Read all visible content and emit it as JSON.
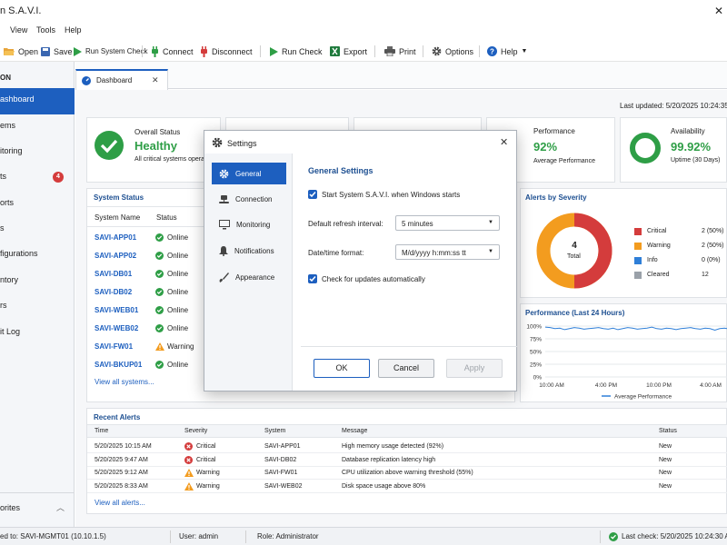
{
  "title": "n S.A.V.I.",
  "menu": [
    "View",
    "Tools",
    "Help"
  ],
  "toolbar": {
    "open": "Open",
    "save": "Save",
    "run_system_check": "Run System Check",
    "connect": "Connect",
    "disconnect": "Disconnect",
    "run_check": "Run Check",
    "export": "Export",
    "print": "Print",
    "options": "Options",
    "help": "Help"
  },
  "sidebar": {
    "header": "ON",
    "items": [
      "ashboard",
      "ems",
      "itoring",
      "ts",
      "orts",
      "s",
      "figurations",
      "ntory",
      "rs",
      "it Log"
    ],
    "alerts_badge": "4",
    "favorites": "orites"
  },
  "tab": {
    "label": "Dashboard"
  },
  "last_updated": "Last updated: 5/20/2025 10:24:35 A",
  "overall": {
    "label": "Overall Status",
    "value": "Healthy",
    "sub": "All critical systems operatio"
  },
  "performance": {
    "label": "Performance",
    "value": "92%",
    "sub": "Average Performance"
  },
  "availability": {
    "label": "Availability",
    "value": "99.92%",
    "sub": "Uptime (30 Days)",
    "fraction": 0.9992
  },
  "system_status": {
    "title": "System Status",
    "headers": [
      "System Name",
      "Status"
    ],
    "rows": [
      {
        "name": "SAVI-APP01",
        "status": "Online"
      },
      {
        "name": "SAVI-APP02",
        "status": "Online"
      },
      {
        "name": "SAVI-DB01",
        "status": "Online"
      },
      {
        "name": "SAVI-DB02",
        "status": "Online"
      },
      {
        "name": "SAVI-WEB01",
        "status": "Online"
      },
      {
        "name": "SAVI-WEB02",
        "status": "Online"
      },
      {
        "name": "SAVI-FW01",
        "status": "Warning"
      },
      {
        "name": "SAVI-BKUP01",
        "status": "Online"
      }
    ],
    "view_all": "View all systems..."
  },
  "alerts_by_severity": {
    "title": "Alerts by Severity",
    "total": "4",
    "total_label": "Total",
    "legend": [
      {
        "label": "Critical",
        "value": "2 (50%)",
        "color": "#d43c3c"
      },
      {
        "label": "Warning",
        "value": "2 (50%)",
        "color": "#f39c1f"
      },
      {
        "label": "Info",
        "value": "0 (0%)",
        "color": "#2f7fd8"
      },
      {
        "label": "Cleared",
        "value": "12",
        "color": "#9aa1a9"
      }
    ]
  },
  "chart_data": {
    "type": "line",
    "title": "Performance (Last 24 Hours)",
    "x": [
      "10:00 AM",
      "4:00 PM",
      "10:00 PM",
      "4:00 AM"
    ],
    "y_ticks": [
      "100%",
      "75%",
      "50%",
      "25%",
      "0%"
    ],
    "ylim": [
      0,
      100
    ],
    "legend": "Average Performance",
    "series": [
      {
        "name": "Average Performance",
        "values": [
          98,
          97,
          95,
          96,
          93,
          95,
          97,
          96,
          94,
          95,
          96,
          97,
          95,
          94,
          96,
          93,
          95,
          97,
          96,
          94,
          95,
          96,
          98,
          95,
          94,
          96,
          95,
          93,
          95,
          96,
          97,
          95,
          94,
          96,
          95,
          92,
          95,
          96,
          94,
          95
        ]
      }
    ]
  },
  "recent_alerts": {
    "title": "Recent Alerts",
    "headers": [
      "Time",
      "Severity",
      "System",
      "Message",
      "Status"
    ],
    "rows": [
      {
        "time": "5/20/2025 10:15 AM",
        "severity": "Critical",
        "system": "SAVI-APP01",
        "message": "High memory usage detected (92%)",
        "status": "New"
      },
      {
        "time": "5/20/2025 9:47 AM",
        "severity": "Critical",
        "system": "SAVI-DB02",
        "message": "Database replication latency high",
        "status": "New"
      },
      {
        "time": "5/20/2025 9:12 AM",
        "severity": "Warning",
        "system": "SAVI-FW01",
        "message": "CPU utilization above warning threshold (55%)",
        "status": "New"
      },
      {
        "time": "5/20/2025 8:33 AM",
        "severity": "Warning",
        "system": "SAVI-WEB02",
        "message": "Disk space usage above 80%",
        "status": "New"
      }
    ],
    "view_all": "View all alerts..."
  },
  "dialog": {
    "title": "Settings",
    "nav": [
      "General",
      "Connection",
      "Monitoring",
      "Notifications",
      "Appearance"
    ],
    "section": "General Settings",
    "start_with_windows": "Start System S.A.V.I. when Windows starts",
    "refresh_label": "Default refresh interval:",
    "refresh_value": "5 minutes",
    "datetime_label": "Date/time format:",
    "datetime_value": "M/d/yyyy h:mm:ss tt",
    "check_updates": "Check for updates automatically",
    "ok": "OK",
    "cancel": "Cancel",
    "apply": "Apply"
  },
  "status": {
    "connected": "ed to: SAVI-MGMT01 (10.10.1.5)",
    "user": "User: admin",
    "role": "Role: Administrator",
    "last_check": "Last check: 5/20/2025 10:24:30 AM"
  }
}
